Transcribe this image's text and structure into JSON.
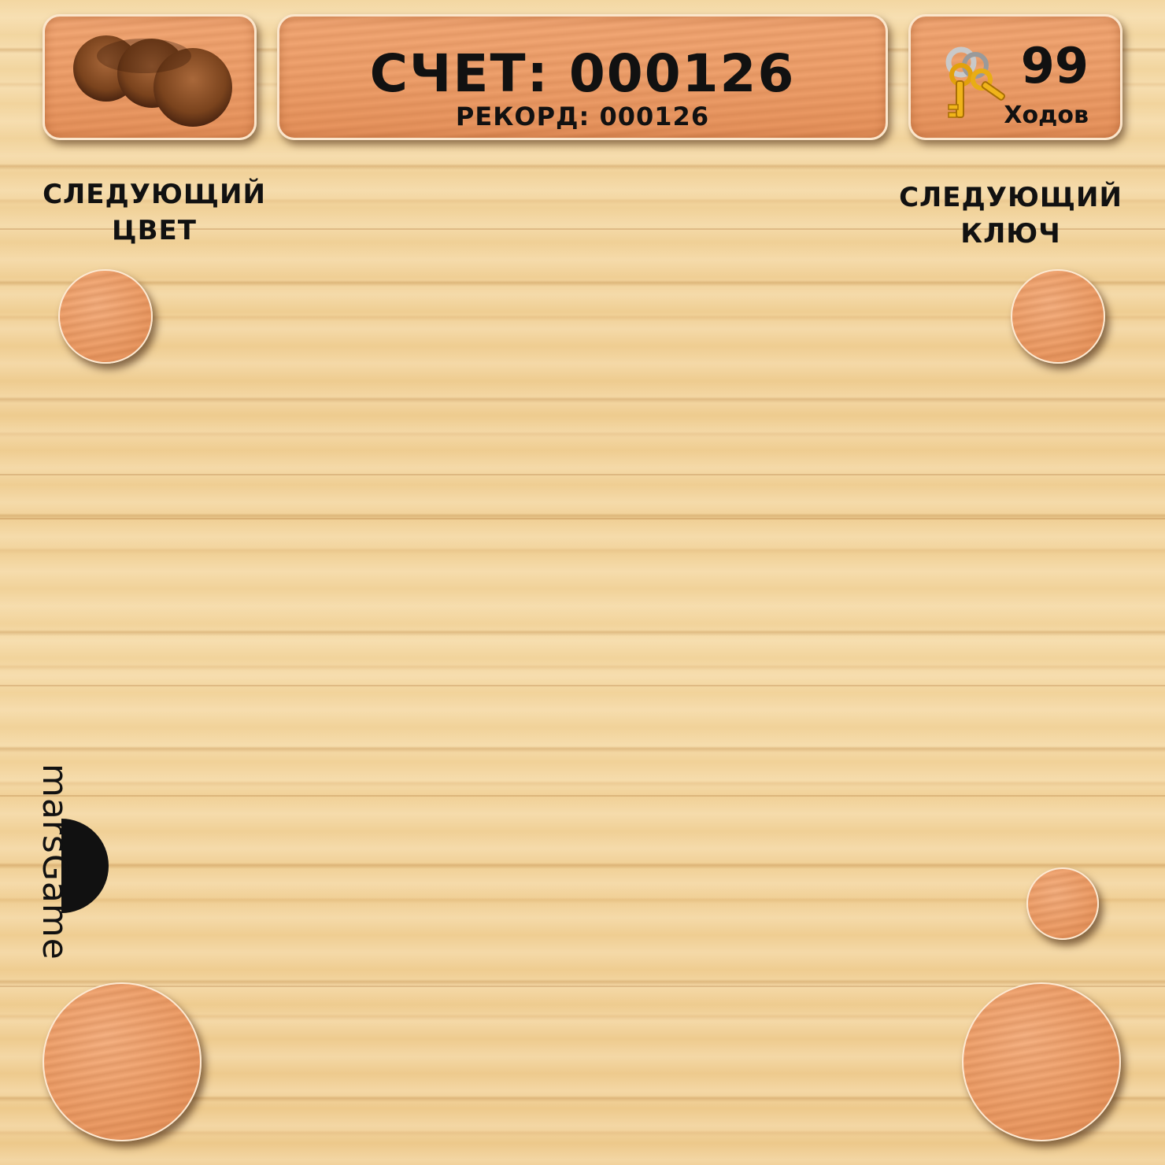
{
  "header": {
    "score_label": "СЧЕТ: 000126",
    "record_label": "РЕКОРД: 000126",
    "moves_count": "99",
    "moves_label": "Ходов"
  },
  "labels": {
    "next_color": "СЛЕДУЮЩИЙ ЦВЕТ",
    "next_key": "СЛЕДУЮЩИЙ КЛЮЧ"
  },
  "logo": {
    "text": "marsGame"
  },
  "icons": {
    "menu": "carved-holes-icon",
    "moves": "keys-icon"
  },
  "colors": {
    "panel_wood": "#eea06c",
    "background_wood": "#f0cf95",
    "text": "#111111"
  }
}
